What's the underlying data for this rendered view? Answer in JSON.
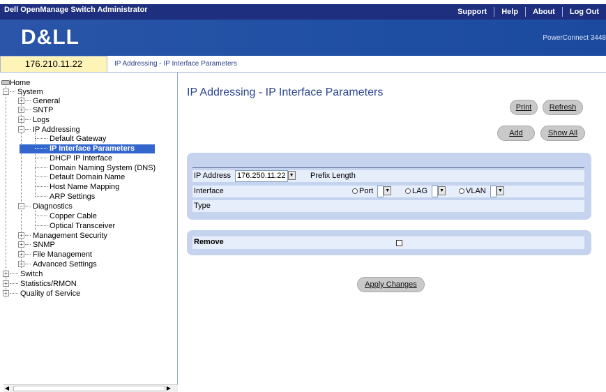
{
  "topbar": {
    "title": "Dell OpenManage Switch Administrator",
    "links": [
      "Support",
      "Help",
      "About",
      "Log Out"
    ]
  },
  "banner": {
    "logo": "D&LL",
    "product": "PowerConnect 3448"
  },
  "address": {
    "ip": "176.210.11.22",
    "breadcrumb": "IP Addressing - IP Interface Parameters"
  },
  "tree": {
    "home": "Home",
    "system": "System",
    "general": "General",
    "sntp": "SNTP",
    "logs": "Logs",
    "ip_addressing": "IP Addressing",
    "default_gateway": "Default Gateway",
    "ip_interface_parameters": "IP Interface Parameters",
    "dhcp_ip_interface": "DHCP IP Interface",
    "dns": "Domain Naming System (DNS)",
    "default_domain_name": "Default Domain Name",
    "host_name_mapping": "Host Name Mapping",
    "arp_settings": "ARP Settings",
    "diagnostics": "Diagnostics",
    "copper_cable": "Copper Cable",
    "optical_transceiver": "Optical Transceiver",
    "management_security": "Management Security",
    "snmp": "SNMP",
    "file_management": "File Management",
    "advanced_settings": "Advanced Settings",
    "switch": "Switch",
    "statistics_rmon": "Statistics/RMON",
    "quality_of_service": "Quality of Service"
  },
  "main": {
    "title": "IP Addressing - IP Interface Parameters",
    "buttons": {
      "print": "Print",
      "refresh": "Refresh",
      "add": "Add",
      "show_all": "Show All",
      "apply": "Apply Changes"
    },
    "form": {
      "ip_address_label": "IP Address",
      "ip_address_value": "176.250.11.22",
      "prefix_length_label": "Prefix Length",
      "interface_label": "Interface",
      "port_label": "Port",
      "lag_label": "LAG",
      "vlan_label": "VLAN",
      "type_label": "Type"
    },
    "remove_label": "Remove"
  },
  "colors": {
    "topbar": "#1d2f7e",
    "banner": "#1f4fa3",
    "panel": "#c6d3ee",
    "selected": "#3366cc",
    "ipbox": "#fff4b8"
  }
}
